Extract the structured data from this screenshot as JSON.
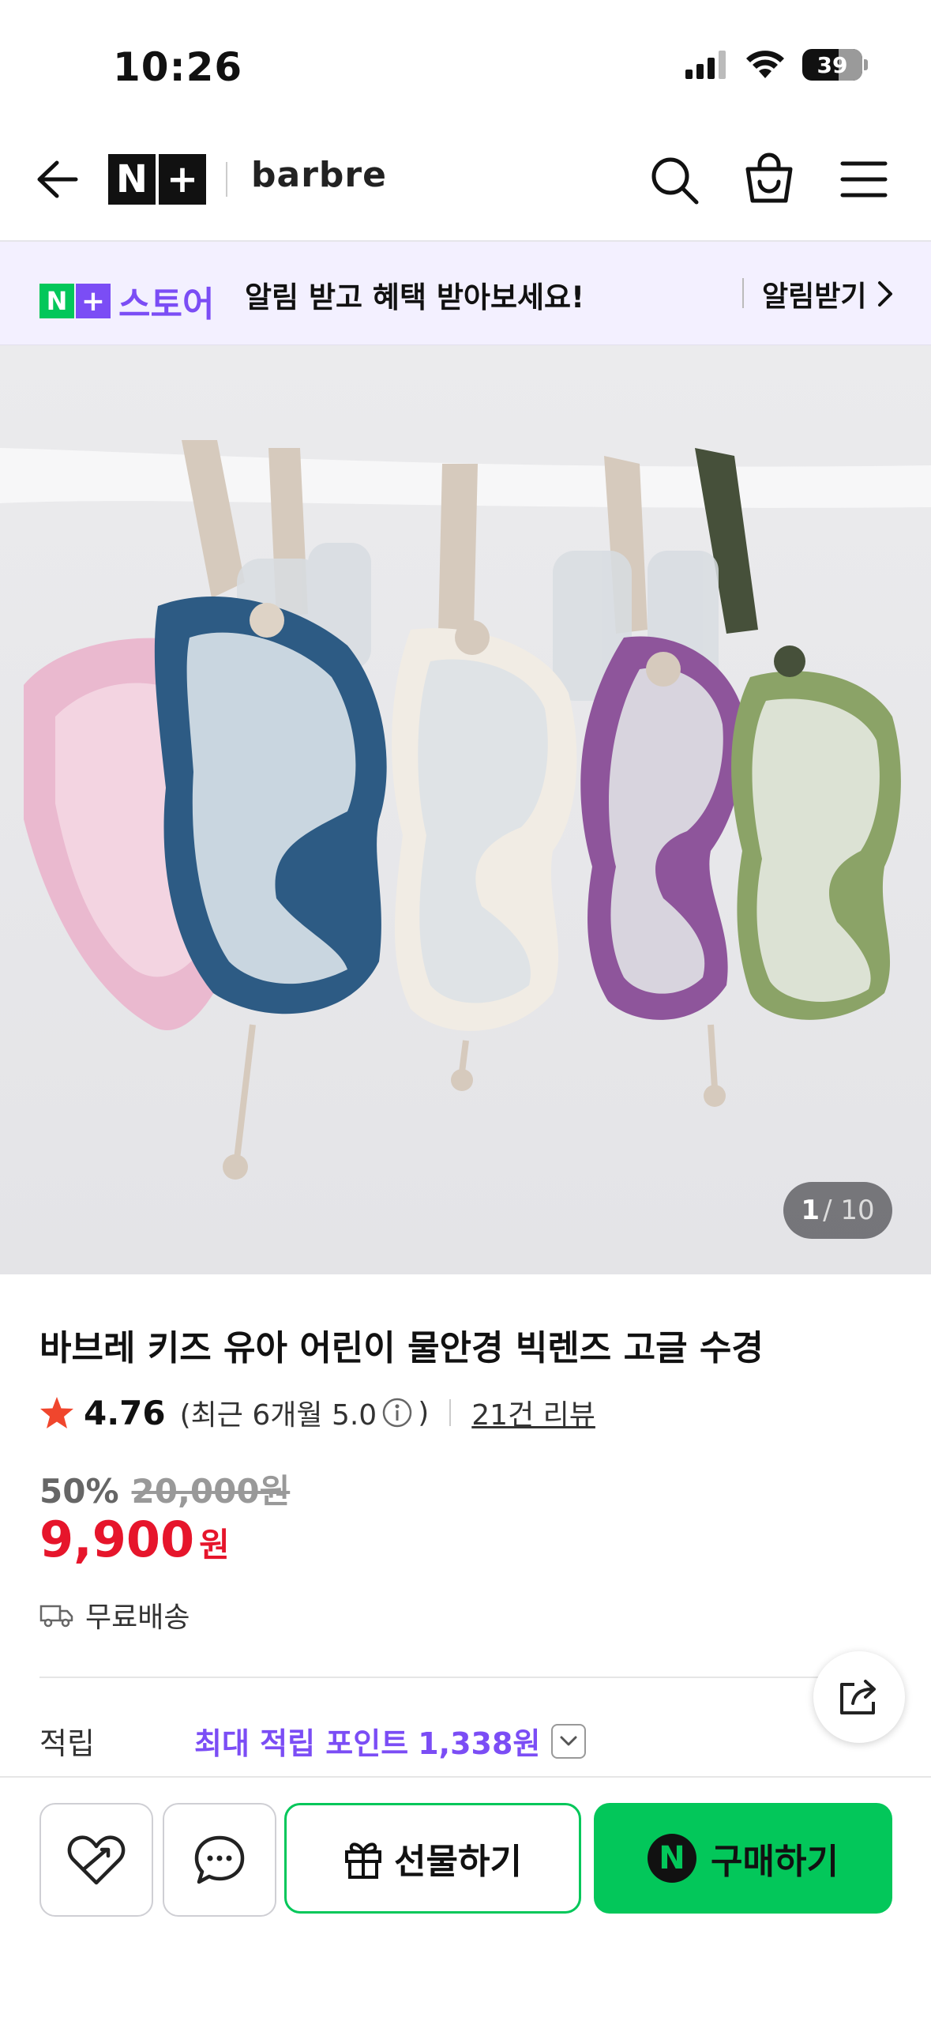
{
  "status_bar": {
    "time": "10:26",
    "battery": "39"
  },
  "header": {
    "logo_n": "N",
    "logo_plus": "+",
    "brand": "barbre"
  },
  "banner": {
    "logo_n": "N",
    "logo_plus": "+",
    "logo_text": "스토어",
    "message": "알림 받고 혜택 받아보세요!",
    "button": "알림받기"
  },
  "gallery": {
    "current": "1",
    "total": "/ 10"
  },
  "product": {
    "title": "바브레 키즈 유아 어린이 물안경 빅렌즈 고글 수경",
    "rating": "4.76",
    "recent_rating_open": "(최근 6개월 5.0",
    "recent_rating_close": ")",
    "review_count": "21건 리뷰",
    "discount": "50%",
    "original_price": "20,000원",
    "price": "9,900",
    "price_unit": "원",
    "shipping": "무료배송",
    "points_label": "적립",
    "points_prefix": "최대 적립 포인트",
    "points_value": "1,338원"
  },
  "actions": {
    "gift": "선물하기",
    "buy_n": "N",
    "buy": "구매하기"
  },
  "colors": {
    "naver_green": "#03c75a",
    "store_purple": "#7b4df5",
    "price_red": "#e6152b",
    "star": "#f0462d"
  },
  "goggle_colors": [
    "pink",
    "navy blue",
    "ivory",
    "purple",
    "olive green"
  ]
}
